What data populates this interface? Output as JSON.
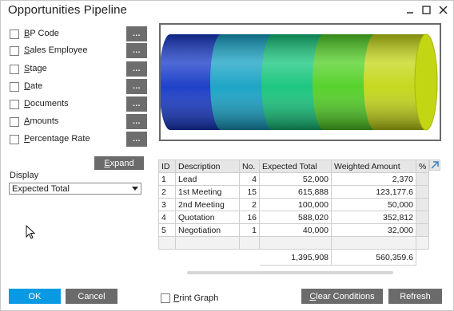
{
  "window": {
    "title": "Opportunities Pipeline"
  },
  "criteria": [
    {
      "label": "BP Code",
      "u": "B",
      "rest": "P Code",
      "button": "..."
    },
    {
      "label": "Sales Employee",
      "u": "S",
      "rest": "ales Employee",
      "button": "..."
    },
    {
      "label": "Stage",
      "u": "S",
      "rest": "tage",
      "button": "..."
    },
    {
      "label": "Date",
      "u": "D",
      "rest": "ate",
      "button": "..."
    },
    {
      "label": "Documents",
      "u": "D",
      "rest": "ocuments",
      "button": "..."
    },
    {
      "label": "Amounts",
      "u": "A",
      "rest": "mounts",
      "button": "..."
    },
    {
      "label": "Percentage Rate",
      "u": "P",
      "rest": "ercentage Rate",
      "button": "..."
    }
  ],
  "expand_button": {
    "u": "E",
    "rest": "xpand"
  },
  "display": {
    "label": "Display",
    "value": "Expected Total"
  },
  "chart_data": {
    "type": "area",
    "title": "",
    "xlabel": "",
    "ylabel": "",
    "categories": [
      "Lead",
      "1st Meeting",
      "2nd Meeting",
      "Quotation",
      "Negotiation"
    ],
    "values": [
      52000,
      615888,
      100000,
      588020,
      40000
    ],
    "colors": [
      "#1437c6",
      "#13a0c4",
      "#12c47a",
      "#4fcf22",
      "#c3d614"
    ]
  },
  "table": {
    "headers": [
      "ID",
      "Description",
      "No.",
      "Expected Total",
      "Weighted Amount",
      "%"
    ],
    "rows": [
      {
        "id": "1",
        "desc": "Lead",
        "no": "4",
        "total": "52,000",
        "weighted": "2,370"
      },
      {
        "id": "2",
        "desc": "1st Meeting",
        "no": "15",
        "total": "615,888",
        "weighted": "123,177.6"
      },
      {
        "id": "3",
        "desc": "2nd Meeting",
        "no": "2",
        "total": "100,000",
        "weighted": "50,000"
      },
      {
        "id": "4",
        "desc": "Quotation",
        "no": "16",
        "total": "588,020",
        "weighted": "352,812"
      },
      {
        "id": "5",
        "desc": "Negotiation",
        "no": "1",
        "total": "40,000",
        "weighted": "32,000"
      }
    ],
    "totals": {
      "total": "1,395,908",
      "weighted": "560,359.6"
    }
  },
  "footer": {
    "ok": "OK",
    "cancel": "Cancel",
    "print_graph": {
      "u": "P",
      "rest": "rint Graph"
    },
    "clear_conditions": {
      "u": "C",
      "rest": "lear Conditions"
    },
    "refresh": "Refresh"
  }
}
